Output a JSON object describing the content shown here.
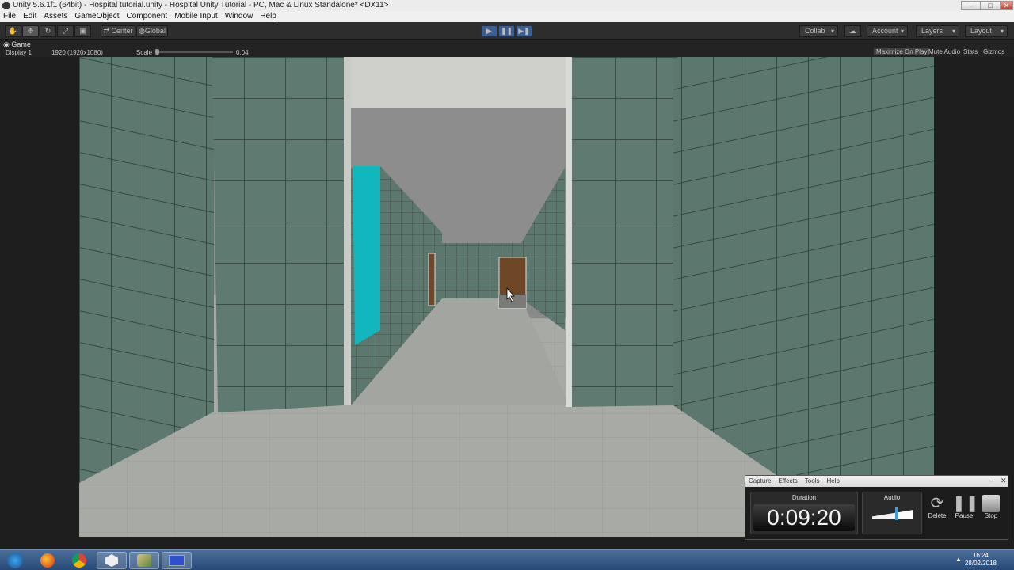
{
  "window": {
    "title": "Unity 5.6.1f1 (64bit) - Hospital tutorial.unity - Hospital Unity Tutorial - PC, Mac & Linux Standalone* <DX11>",
    "min_label": "–",
    "max_label": "□",
    "close_label": "✕"
  },
  "menu": [
    "File",
    "Edit",
    "Assets",
    "GameObject",
    "Component",
    "Mobile Input",
    "Window",
    "Help"
  ],
  "toolbar": {
    "pivot": "Center",
    "space": "Global",
    "collab": "Collab",
    "account": "Account",
    "layers": "Layers",
    "layout": "Layout"
  },
  "game": {
    "tab": "Game",
    "display": "Display 1",
    "resolution": "1920 (1920x1080)",
    "scale_label": "Scale",
    "scale_value": "0.04",
    "maximize": "Maximize On Play",
    "mute": "Mute Audio",
    "stats": "Stats",
    "gizmos": "Gizmos"
  },
  "capture": {
    "menu": [
      "Capture",
      "Effects",
      "Tools",
      "Help"
    ],
    "duration_label": "Duration",
    "duration": "0:09:20",
    "audio_label": "Audio",
    "audio_level": 0.55,
    "delete": "Delete",
    "pause": "Pause",
    "stop": "Stop"
  },
  "taskbar": {
    "time": "16:24",
    "date": "28/02/2018"
  },
  "colors": {
    "wall": "#5e7a70",
    "floor": "#a9aca6",
    "door": "#6e4826",
    "glass": "#12b7bd"
  }
}
